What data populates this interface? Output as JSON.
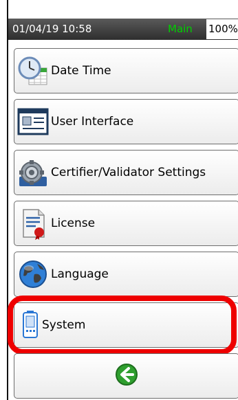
{
  "status_bar": {
    "datetime": "01/04/19 10:58",
    "mode": "Main",
    "battery": "100%",
    "mode_color": "#00d000"
  },
  "menu": {
    "items": [
      {
        "label": "Date Time",
        "icon": "clock-calendar-icon"
      },
      {
        "label": "User Interface",
        "icon": "window-icon"
      },
      {
        "label": "Certifier/Validator Settings",
        "icon": "gear-icon"
      },
      {
        "label": "License",
        "icon": "license-document-icon"
      },
      {
        "label": "Language",
        "icon": "globe-icon"
      },
      {
        "label": "System",
        "icon": "device-icon"
      }
    ],
    "back_icon": "back-arrow-icon"
  },
  "highlight": {
    "target": "System",
    "color": "#ee0000"
  }
}
